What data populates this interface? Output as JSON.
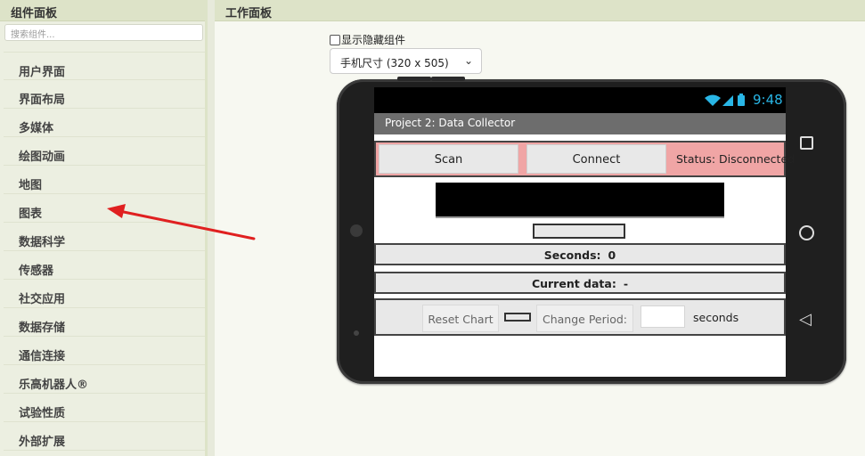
{
  "palette": {
    "title": "组件面板",
    "search_placeholder": "搜索组件...",
    "categories": [
      "用户界面",
      "界面布局",
      "多媒体",
      "绘图动画",
      "地图",
      "图表",
      "数据科学",
      "传感器",
      "社交应用",
      "数据存储",
      "通信连接",
      "乐高机器人®",
      "试验性质",
      "外部扩展"
    ]
  },
  "workspace": {
    "title": "工作面板",
    "show_hidden_label": "显示隐藏组件",
    "size_select": "手机尺寸 (320 x 505)"
  },
  "phone": {
    "status_icons": "📶🔋",
    "clock": "9:48",
    "app_title": "Project 2: Data Collector",
    "scan_label": "Scan",
    "connect_label": "Connect",
    "status_text": "Status: Disconnected",
    "seconds_label": "Seconds:",
    "seconds_value": "0",
    "current_label": "Current data:",
    "current_value": "-",
    "reset_label": "Reset Chart",
    "change_period_label": "Change Period:",
    "period_value": "",
    "seconds_unit": "seconds"
  },
  "colors": {
    "accent_arrow": "#e02020",
    "status_bar_text": "#29b6e6",
    "top_row_bg": "#f0a5a5"
  }
}
